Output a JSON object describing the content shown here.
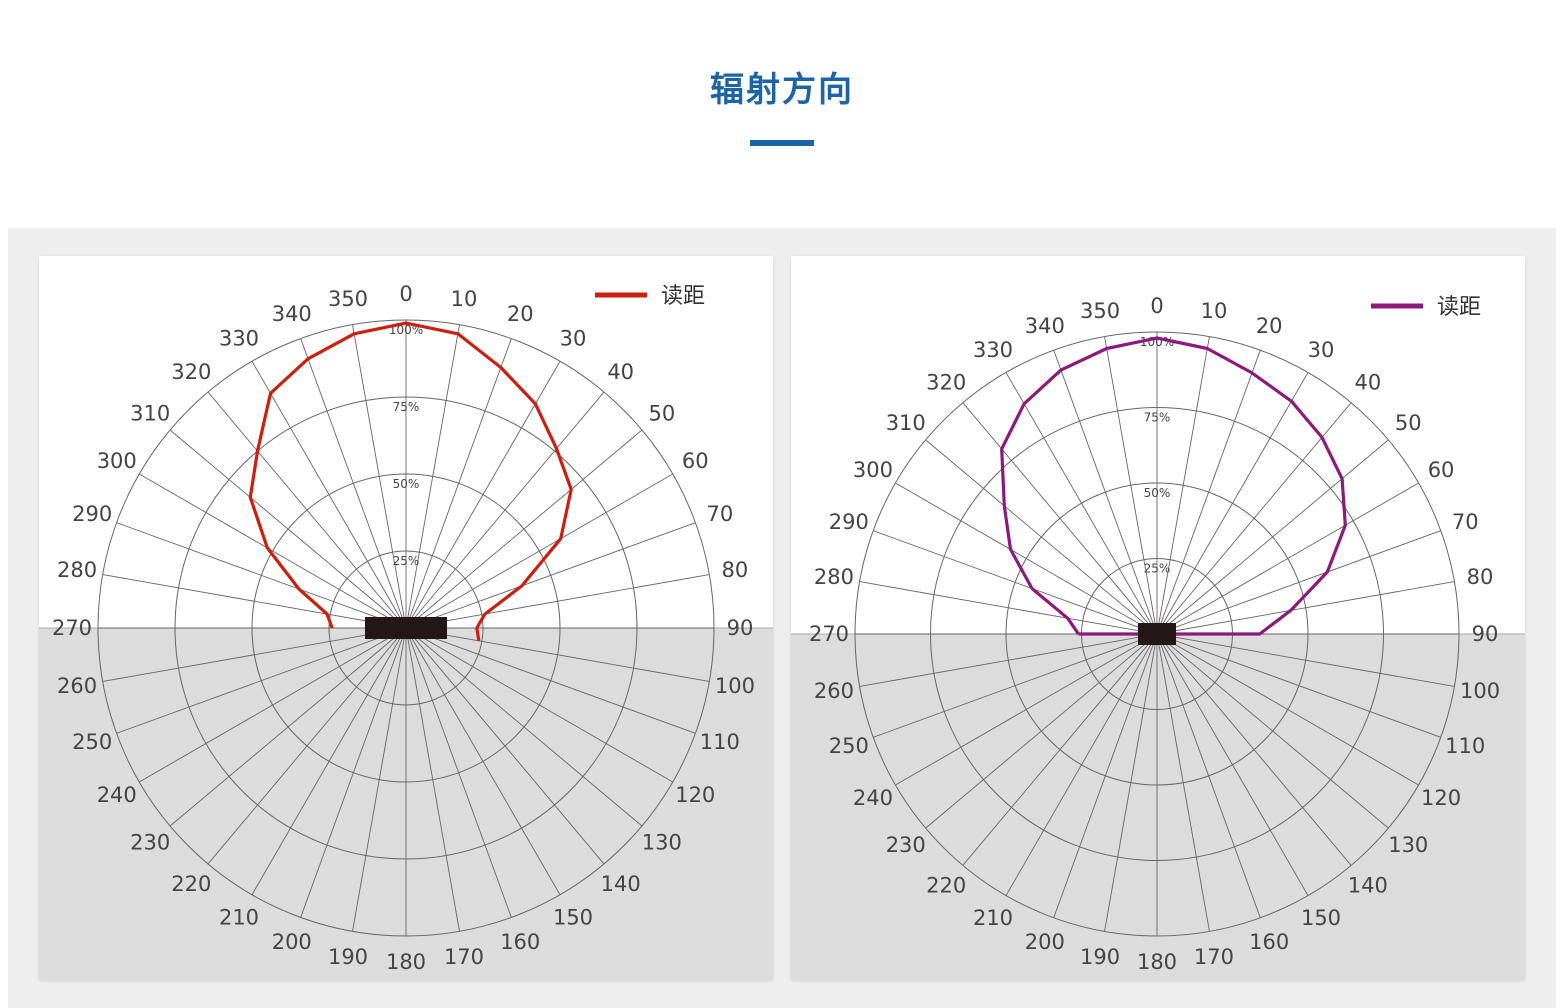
{
  "page": {
    "title": "辐射方向"
  },
  "colors": {
    "title": "#1b64a6",
    "lower_hemisphere_fill": "#dcdcdc",
    "grid": "#666666",
    "antenna": "#231815"
  },
  "chart_data": [
    {
      "type": "polar-line",
      "legend_position": "top-right",
      "angle_ticks": [
        "0",
        "10",
        "20",
        "30",
        "40",
        "50",
        "60",
        "70",
        "80",
        "90",
        "100",
        "110",
        "120",
        "130",
        "140",
        "150",
        "160",
        "170",
        "180",
        "190",
        "200",
        "210",
        "220",
        "230",
        "240",
        "250",
        "260",
        "270",
        "280",
        "290",
        "300",
        "310",
        "320",
        "330",
        "340",
        "350"
      ],
      "radial_ticks": [
        "25%",
        "50%",
        "75%",
        "100%"
      ],
      "rlim": [
        0,
        100
      ],
      "series": [
        {
          "name": "读距",
          "color": "#cc1f0f",
          "points": [
            {
              "angle": 270,
              "r": 24
            },
            {
              "angle": 280,
              "r": 26
            },
            {
              "angle": 290,
              "r": 37
            },
            {
              "angle": 300,
              "r": 52
            },
            {
              "angle": 310,
              "r": 66
            },
            {
              "angle": 320,
              "r": 75
            },
            {
              "angle": 330,
              "r": 88
            },
            {
              "angle": 340,
              "r": 93
            },
            {
              "angle": 350,
              "r": 97
            },
            {
              "angle": 0,
              "r": 99
            },
            {
              "angle": 10,
              "r": 97
            },
            {
              "angle": 20,
              "r": 90
            },
            {
              "angle": 30,
              "r": 84
            },
            {
              "angle": 40,
              "r": 76
            },
            {
              "angle": 50,
              "r": 70
            },
            {
              "angle": 60,
              "r": 58
            },
            {
              "angle": 70,
              "r": 40
            },
            {
              "angle": 80,
              "r": 26
            },
            {
              "angle": 90,
              "r": 23
            },
            {
              "angle": 100,
              "r": 24
            }
          ]
        }
      ]
    },
    {
      "type": "polar-line",
      "legend_position": "top-right",
      "angle_ticks": [
        "0",
        "10",
        "20",
        "30",
        "40",
        "50",
        "60",
        "70",
        "80",
        "90",
        "100",
        "110",
        "120",
        "130",
        "140",
        "150",
        "160",
        "170",
        "180",
        "190",
        "200",
        "210",
        "220",
        "230",
        "240",
        "250",
        "260",
        "270",
        "280",
        "290",
        "300",
        "310",
        "320",
        "330",
        "340",
        "350"
      ],
      "radial_ticks": [
        "25%",
        "50%",
        "75%",
        "100%"
      ],
      "rlim": [
        0,
        100
      ],
      "series": [
        {
          "name": "读距",
          "color": "#8c1a7e",
          "points": [
            {
              "angle": 270,
              "r": 26
            },
            {
              "angle": 280,
              "r": 30
            },
            {
              "angle": 290,
              "r": 44
            },
            {
              "angle": 300,
              "r": 56
            },
            {
              "angle": 310,
              "r": 66
            },
            {
              "angle": 320,
              "r": 80
            },
            {
              "angle": 330,
              "r": 88
            },
            {
              "angle": 340,
              "r": 93
            },
            {
              "angle": 350,
              "r": 96
            },
            {
              "angle": 0,
              "r": 98
            },
            {
              "angle": 10,
              "r": 96
            },
            {
              "angle": 20,
              "r": 92
            },
            {
              "angle": 30,
              "r": 89
            },
            {
              "angle": 40,
              "r": 85
            },
            {
              "angle": 50,
              "r": 80
            },
            {
              "angle": 60,
              "r": 72
            },
            {
              "angle": 70,
              "r": 60
            },
            {
              "angle": 80,
              "r": 45
            },
            {
              "angle": 90,
              "r": 34
            },
            {
              "angle": 270,
              "r": 26
            }
          ]
        }
      ]
    }
  ]
}
